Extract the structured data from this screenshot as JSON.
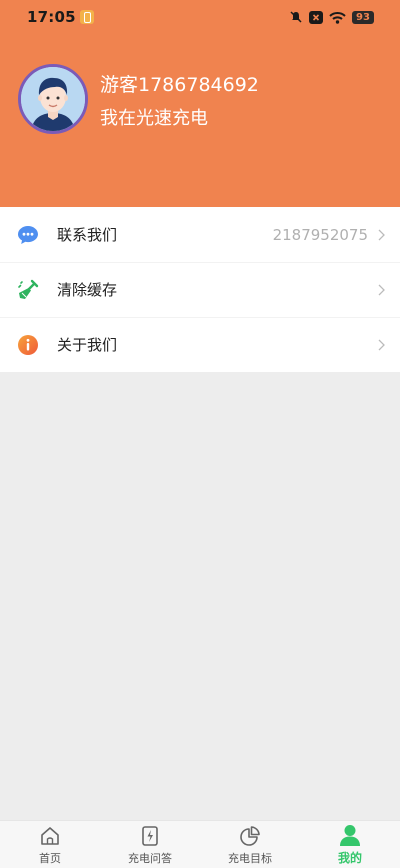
{
  "status_bar": {
    "time": "17:05",
    "battery": "93"
  },
  "profile": {
    "username": "游客1786784692",
    "tagline": "我在光速充电"
  },
  "menu": {
    "items": [
      {
        "label": "联系我们",
        "value": "2187952075",
        "icon": "chat-bubble-icon"
      },
      {
        "label": "清除缓存",
        "value": "",
        "icon": "broom-icon"
      },
      {
        "label": "关于我们",
        "value": "",
        "icon": "info-icon"
      }
    ]
  },
  "tabbar": {
    "tabs": [
      {
        "label": "首页",
        "icon": "home-icon"
      },
      {
        "label": "充电问答",
        "icon": "charge-qa-icon"
      },
      {
        "label": "充电目标",
        "icon": "pie-chart-icon"
      },
      {
        "label": "我的",
        "icon": "person-icon",
        "active": true
      }
    ]
  },
  "colors": {
    "header": "#f0834f",
    "accent": "#34c66b",
    "avatar_ring": "#7b5bb8"
  }
}
